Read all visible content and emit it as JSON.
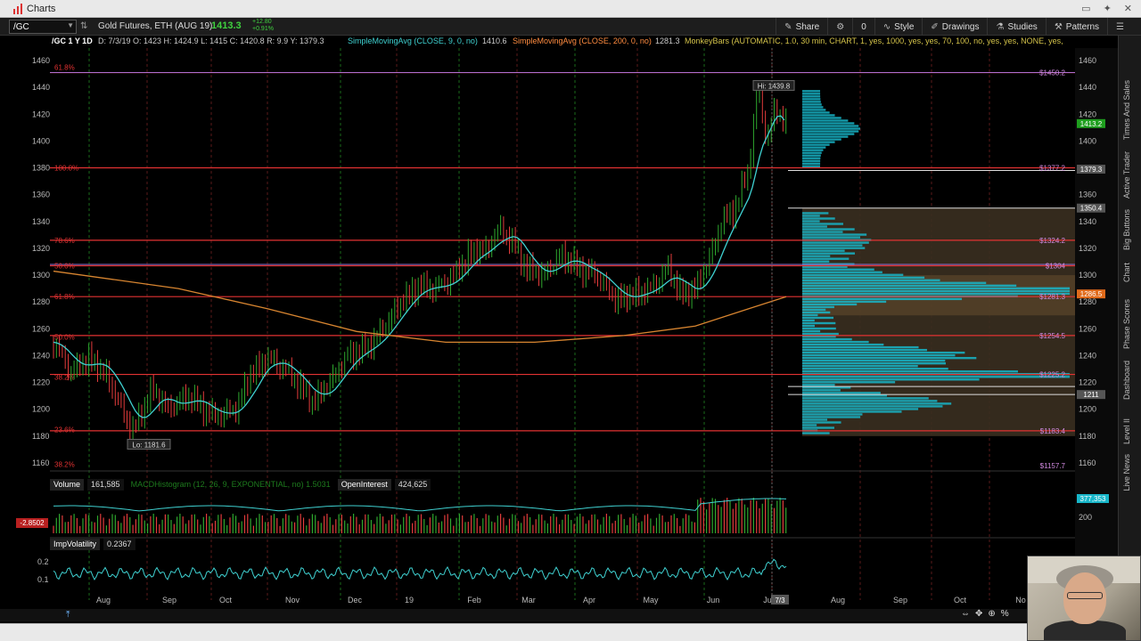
{
  "window": {
    "title": "Charts"
  },
  "toolbar": {
    "symbol": "/GC",
    "description": "Gold Futures, ETH (AUG 19)",
    "last_price": "1413.3",
    "change_abs": "+12.80",
    "change_pct": "+0.91%",
    "share_label": "Share",
    "alert_count": "0",
    "style_label": "Style",
    "drawings_label": "Drawings",
    "studies_label": "Studies",
    "patterns_label": "Patterns"
  },
  "infobar": {
    "symbol_period": "/GC 1 Y 1D",
    "ohlc": "D: 7/3/19  O: 1423  H: 1424.9  L: 1415  C: 1420.8  R: 9.9  Y: 1379.3",
    "sma9_label": "SimpleMovingAvg (CLOSE, 9, 0, no)",
    "sma9_value": "1410.6",
    "sma200_label": "SimpleMovingAvg (CLOSE, 200, 0, no)",
    "sma200_value": "1281.3",
    "monkeybars_label": "MonkeyBars (AUTOMATIC, 1.0, 30 min, CHART, 1, yes, 1000, yes, yes, 70, 100, no, yes, yes, NONE, yes,"
  },
  "chart": {
    "hi_label": "Hi: 1439.8",
    "lo_label": "Lo: 1181.6",
    "price_axis_ticks": [
      "1460",
      "1440",
      "1420",
      "1400",
      "1380",
      "1360",
      "1340",
      "1320",
      "1300",
      "1280",
      "1260",
      "1240",
      "1220",
      "1200",
      "1180",
      "1160"
    ],
    "fib_labels": [
      {
        "text": "61.8%",
        "price": 1455
      },
      {
        "text": "100.0%",
        "price": 1380
      },
      {
        "text": "78.6%",
        "price": 1326
      },
      {
        "text": "50.0%",
        "price": 1307
      },
      {
        "text": "61.8%",
        "price": 1284
      },
      {
        "text": "50.0%",
        "price": 1254
      },
      {
        "text": "38.2%",
        "price": 1224
      },
      {
        "text": "23.6%",
        "price": 1185
      },
      {
        "text": "38.2%",
        "price": 1159
      }
    ],
    "right_level_labels": [
      {
        "text": "$1450.2",
        "price": 1451
      },
      {
        "text": "$1377.2",
        "price": 1380
      },
      {
        "text": "$1324.2",
        "price": 1326
      },
      {
        "text": "$1304",
        "price": 1307
      },
      {
        "text": "$1281.3",
        "price": 1284
      },
      {
        "text": "$1254.5",
        "price": 1255
      },
      {
        "text": "$1225.2",
        "price": 1226
      },
      {
        "text": "$1183.4",
        "price": 1184
      },
      {
        "text": "$1157.7",
        "price": 1158
      }
    ],
    "axis_badges": [
      {
        "text": "1413.2",
        "color": "#1e9e1e",
        "price": 1413
      },
      {
        "text": "1379.3",
        "color": "#555555",
        "price": 1379
      },
      {
        "text": "1350.4",
        "color": "#555555",
        "price": 1350
      },
      {
        "text": "1286.5",
        "color": "#e06a1a",
        "price": 1286
      },
      {
        "text": "1211",
        "color": "#555555",
        "price": 1211
      }
    ],
    "lower_badge_value": "-2.8502",
    "volume_badge_value": "377,353",
    "time_axis_labels": [
      "Aug",
      "Sep",
      "Oct",
      "Nov",
      "Dec",
      "19",
      "Feb",
      "Mar",
      "Apr",
      "May",
      "Jun",
      "Jul",
      "7/3",
      "Aug",
      "Sep",
      "Oct",
      "No"
    ]
  },
  "volume_panel": {
    "label": "Volume",
    "value": "161,585",
    "macd_label": "MACDHistogram (12, 26, 9, EXPONENTIAL, no)",
    "macd_value": "1.5031",
    "oi_label": "OpenInterest",
    "oi_value": "424,625",
    "y_ticks": [
      "200"
    ]
  },
  "iv_panel": {
    "label": "ImpVolatility",
    "value": "0.2367",
    "y_ticks": [
      "0.2",
      "0.1"
    ]
  },
  "right_rail": {
    "tabs": [
      "Times And Sales",
      "Active Trader",
      "Big Buttons",
      "Chart",
      "Phase Scores",
      "Dashboard",
      "Level II",
      "Live News"
    ]
  },
  "colors": {
    "up": "#2ea82e",
    "down": "#e23b3b",
    "sma9": "#3fd1d1",
    "sma200": "#d88530",
    "profile": "#17b6c9",
    "fib_line": "#e23232",
    "accent_green": "#3fd13f"
  }
}
